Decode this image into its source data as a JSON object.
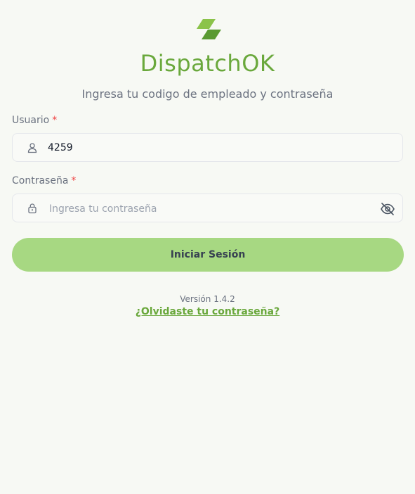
{
  "brand": {
    "name": "DispatchOK",
    "logo_icon": "logo-mark-icon",
    "color": "#6aa83c"
  },
  "subtitle": "Ingresa tu codigo de empleado y contraseña",
  "user_field": {
    "label": "Usuario",
    "required_mark": "*",
    "value": "4259",
    "icon": "user-icon"
  },
  "password_field": {
    "label": "Contraseña",
    "required_mark": "*",
    "placeholder": "Ingresa tu contraseña",
    "icon": "lock-icon",
    "toggle_icon": "eye-off-icon"
  },
  "submit": {
    "label": "Iniciar Sesión",
    "color": "#a7d882"
  },
  "version": "Versión 1.4.2",
  "forgot_link": "¿Olvidaste tu contraseña?"
}
